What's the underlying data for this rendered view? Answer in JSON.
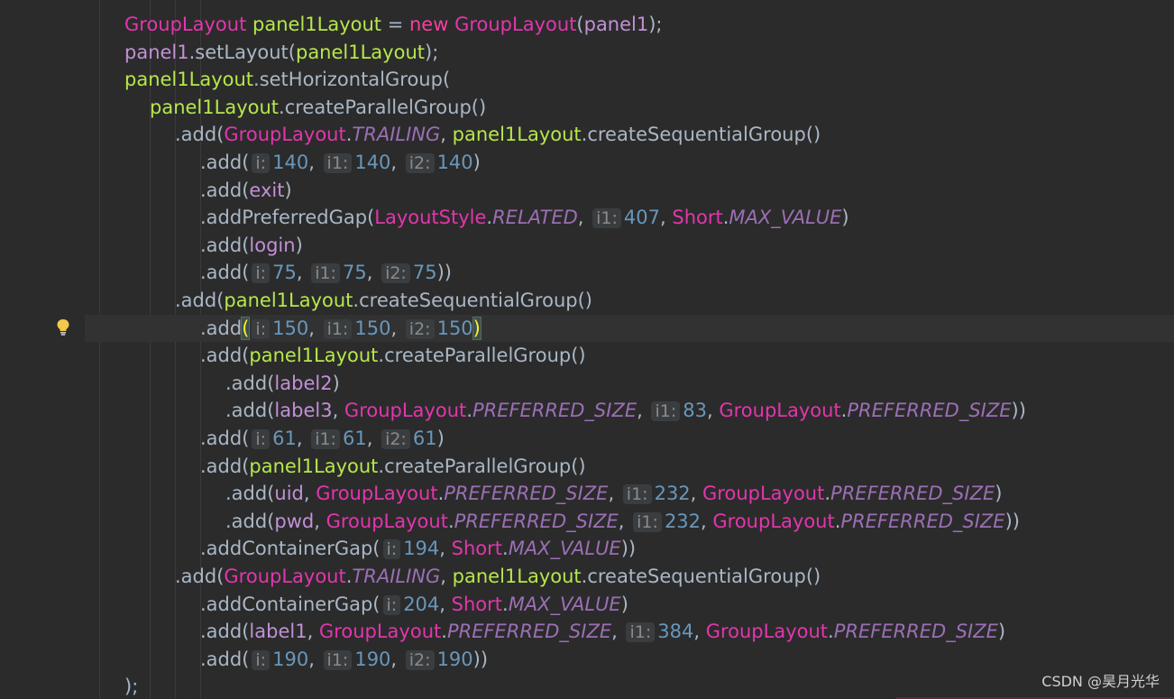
{
  "editor": {
    "watermark": "CSDN @昊月光华",
    "lines": [
      [
        {
          "t": "type",
          "v": "GroupLayout"
        },
        {
          "t": "plain",
          "v": " "
        },
        {
          "t": "var",
          "v": "panel1Layout"
        },
        {
          "t": "plain",
          "v": " = "
        },
        {
          "t": "kw",
          "v": "new"
        },
        {
          "t": "plain",
          "v": " "
        },
        {
          "t": "type",
          "v": "GroupLayout"
        },
        {
          "t": "plain",
          "v": "("
        },
        {
          "t": "ident",
          "v": "panel1"
        },
        {
          "t": "plain",
          "v": ");"
        }
      ],
      [
        {
          "t": "ident",
          "v": "panel1"
        },
        {
          "t": "plain",
          "v": ".setLayout("
        },
        {
          "t": "var",
          "v": "panel1Layout"
        },
        {
          "t": "plain",
          "v": ");"
        }
      ],
      [
        {
          "t": "var",
          "v": "panel1Layout"
        },
        {
          "t": "plain",
          "v": ".setHorizontalGroup("
        }
      ],
      [
        {
          "t": "var",
          "v": "panel1Layout"
        },
        {
          "t": "plain",
          "v": ".createParallelGroup()"
        }
      ],
      [
        {
          "t": "plain",
          "v": ".add("
        },
        {
          "t": "type",
          "v": "GroupLayout"
        },
        {
          "t": "plain",
          "v": "."
        },
        {
          "t": "field",
          "v": "TRAILING"
        },
        {
          "t": "plain",
          "v": ", "
        },
        {
          "t": "var",
          "v": "panel1Layout"
        },
        {
          "t": "plain",
          "v": ".createSequentialGroup()"
        }
      ],
      [
        {
          "t": "plain",
          "v": ".add("
        },
        {
          "t": "hint",
          "v": "i:"
        },
        {
          "t": "num",
          "v": "140"
        },
        {
          "t": "plain",
          "v": ", "
        },
        {
          "t": "hint",
          "v": "i1:"
        },
        {
          "t": "num",
          "v": "140"
        },
        {
          "t": "plain",
          "v": ", "
        },
        {
          "t": "hint",
          "v": "i2:"
        },
        {
          "t": "num",
          "v": "140"
        },
        {
          "t": "plain",
          "v": ")"
        }
      ],
      [
        {
          "t": "plain",
          "v": ".add("
        },
        {
          "t": "ident",
          "v": "exit"
        },
        {
          "t": "plain",
          "v": ")"
        }
      ],
      [
        {
          "t": "plain",
          "v": ".addPreferredGap("
        },
        {
          "t": "type",
          "v": "LayoutStyle"
        },
        {
          "t": "plain",
          "v": "."
        },
        {
          "t": "field",
          "v": "RELATED"
        },
        {
          "t": "plain",
          "v": ", "
        },
        {
          "t": "hint",
          "v": "i1:"
        },
        {
          "t": "num",
          "v": "407"
        },
        {
          "t": "plain",
          "v": ", "
        },
        {
          "t": "type",
          "v": "Short"
        },
        {
          "t": "plain",
          "v": "."
        },
        {
          "t": "field",
          "v": "MAX_VALUE"
        },
        {
          "t": "plain",
          "v": ")"
        }
      ],
      [
        {
          "t": "plain",
          "v": ".add("
        },
        {
          "t": "ident",
          "v": "login"
        },
        {
          "t": "plain",
          "v": ")"
        }
      ],
      [
        {
          "t": "plain",
          "v": ".add("
        },
        {
          "t": "hint",
          "v": "i:"
        },
        {
          "t": "num",
          "v": "75"
        },
        {
          "t": "plain",
          "v": ", "
        },
        {
          "t": "hint",
          "v": "i1:"
        },
        {
          "t": "num",
          "v": "75"
        },
        {
          "t": "plain",
          "v": ", "
        },
        {
          "t": "hint",
          "v": "i2:"
        },
        {
          "t": "num",
          "v": "75"
        },
        {
          "t": "plain",
          "v": "))"
        }
      ],
      [
        {
          "t": "plain",
          "v": ".add("
        },
        {
          "t": "var",
          "v": "panel1Layout"
        },
        {
          "t": "plain",
          "v": ".createSequentialGroup()"
        }
      ],
      [
        {
          "t": "plain",
          "v": ".add"
        },
        {
          "t": "bracket",
          "v": "("
        },
        {
          "t": "hint",
          "v": "i:"
        },
        {
          "t": "num",
          "v": "150"
        },
        {
          "t": "plain",
          "v": ", "
        },
        {
          "t": "hint",
          "v": "i1:"
        },
        {
          "t": "num",
          "v": "150"
        },
        {
          "t": "plain",
          "v": ", "
        },
        {
          "t": "hint",
          "v": "i2:"
        },
        {
          "t": "num",
          "v": "150"
        },
        {
          "t": "bracket",
          "v": ")"
        }
      ],
      [
        {
          "t": "plain",
          "v": ".add("
        },
        {
          "t": "var",
          "v": "panel1Layout"
        },
        {
          "t": "plain",
          "v": ".createParallelGroup()"
        }
      ],
      [
        {
          "t": "plain",
          "v": ".add("
        },
        {
          "t": "ident",
          "v": "label2"
        },
        {
          "t": "plain",
          "v": ")"
        }
      ],
      [
        {
          "t": "plain",
          "v": ".add("
        },
        {
          "t": "ident",
          "v": "label3"
        },
        {
          "t": "plain",
          "v": ", "
        },
        {
          "t": "type",
          "v": "GroupLayout"
        },
        {
          "t": "plain",
          "v": "."
        },
        {
          "t": "field",
          "v": "PREFERRED_SIZE"
        },
        {
          "t": "plain",
          "v": ", "
        },
        {
          "t": "hint",
          "v": "i1:"
        },
        {
          "t": "num",
          "v": "83"
        },
        {
          "t": "plain",
          "v": ", "
        },
        {
          "t": "type",
          "v": "GroupLayout"
        },
        {
          "t": "plain",
          "v": "."
        },
        {
          "t": "field",
          "v": "PREFERRED_SIZE"
        },
        {
          "t": "plain",
          "v": "))"
        }
      ],
      [
        {
          "t": "plain",
          "v": ".add("
        },
        {
          "t": "hint",
          "v": "i:"
        },
        {
          "t": "num",
          "v": "61"
        },
        {
          "t": "plain",
          "v": ", "
        },
        {
          "t": "hint",
          "v": "i1:"
        },
        {
          "t": "num",
          "v": "61"
        },
        {
          "t": "plain",
          "v": ", "
        },
        {
          "t": "hint",
          "v": "i2:"
        },
        {
          "t": "num",
          "v": "61"
        },
        {
          "t": "plain",
          "v": ")"
        }
      ],
      [
        {
          "t": "plain",
          "v": ".add("
        },
        {
          "t": "var",
          "v": "panel1Layout"
        },
        {
          "t": "plain",
          "v": ".createParallelGroup()"
        }
      ],
      [
        {
          "t": "plain",
          "v": ".add("
        },
        {
          "t": "ident",
          "v": "uid"
        },
        {
          "t": "plain",
          "v": ", "
        },
        {
          "t": "type",
          "v": "GroupLayout"
        },
        {
          "t": "plain",
          "v": "."
        },
        {
          "t": "field",
          "v": "PREFERRED_SIZE"
        },
        {
          "t": "plain",
          "v": ", "
        },
        {
          "t": "hint",
          "v": "i1:"
        },
        {
          "t": "num",
          "v": "232"
        },
        {
          "t": "plain",
          "v": ", "
        },
        {
          "t": "type",
          "v": "GroupLayout"
        },
        {
          "t": "plain",
          "v": "."
        },
        {
          "t": "field",
          "v": "PREFERRED_SIZE"
        },
        {
          "t": "plain",
          "v": ")"
        }
      ],
      [
        {
          "t": "plain",
          "v": ".add("
        },
        {
          "t": "ident",
          "v": "pwd"
        },
        {
          "t": "plain",
          "v": ", "
        },
        {
          "t": "type",
          "v": "GroupLayout"
        },
        {
          "t": "plain",
          "v": "."
        },
        {
          "t": "field",
          "v": "PREFERRED_SIZE"
        },
        {
          "t": "plain",
          "v": ", "
        },
        {
          "t": "hint",
          "v": "i1:"
        },
        {
          "t": "num",
          "v": "232"
        },
        {
          "t": "plain",
          "v": ", "
        },
        {
          "t": "type",
          "v": "GroupLayout"
        },
        {
          "t": "plain",
          "v": "."
        },
        {
          "t": "field",
          "v": "PREFERRED_SIZE"
        },
        {
          "t": "plain",
          "v": "))"
        }
      ],
      [
        {
          "t": "plain",
          "v": ".addContainerGap("
        },
        {
          "t": "hint",
          "v": "i:"
        },
        {
          "t": "num",
          "v": "194"
        },
        {
          "t": "plain",
          "v": ", "
        },
        {
          "t": "type",
          "v": "Short"
        },
        {
          "t": "plain",
          "v": "."
        },
        {
          "t": "field",
          "v": "MAX_VALUE"
        },
        {
          "t": "plain",
          "v": "))"
        }
      ],
      [
        {
          "t": "plain",
          "v": ".add("
        },
        {
          "t": "type",
          "v": "GroupLayout"
        },
        {
          "t": "plain",
          "v": "."
        },
        {
          "t": "field",
          "v": "TRAILING"
        },
        {
          "t": "plain",
          "v": ", "
        },
        {
          "t": "var",
          "v": "panel1Layout"
        },
        {
          "t": "plain",
          "v": ".createSequentialGroup()"
        }
      ],
      [
        {
          "t": "plain",
          "v": ".addContainerGap("
        },
        {
          "t": "hint",
          "v": "i:"
        },
        {
          "t": "num",
          "v": "204"
        },
        {
          "t": "plain",
          "v": ", "
        },
        {
          "t": "type",
          "v": "Short"
        },
        {
          "t": "plain",
          "v": "."
        },
        {
          "t": "field",
          "v": "MAX_VALUE"
        },
        {
          "t": "plain",
          "v": ")"
        }
      ],
      [
        {
          "t": "plain",
          "v": ".add("
        },
        {
          "t": "ident",
          "v": "label1"
        },
        {
          "t": "plain",
          "v": ", "
        },
        {
          "t": "type",
          "v": "GroupLayout"
        },
        {
          "t": "plain",
          "v": "."
        },
        {
          "t": "field",
          "v": "PREFERRED_SIZE"
        },
        {
          "t": "plain",
          "v": ", "
        },
        {
          "t": "hint",
          "v": "i1:"
        },
        {
          "t": "num",
          "v": "384"
        },
        {
          "t": "plain",
          "v": ", "
        },
        {
          "t": "type",
          "v": "GroupLayout"
        },
        {
          "t": "plain",
          "v": "."
        },
        {
          "t": "field",
          "v": "PREFERRED_SIZE"
        },
        {
          "t": "plain",
          "v": ")"
        }
      ],
      [
        {
          "t": "plain",
          "v": ".add("
        },
        {
          "t": "hint",
          "v": "i:"
        },
        {
          "t": "num",
          "v": "190"
        },
        {
          "t": "plain",
          "v": ", "
        },
        {
          "t": "hint",
          "v": "i1:"
        },
        {
          "t": "num",
          "v": "190"
        },
        {
          "t": "plain",
          "v": ", "
        },
        {
          "t": "hint",
          "v": "i2:"
        },
        {
          "t": "num",
          "v": "190"
        },
        {
          "t": "plain",
          "v": "))"
        }
      ],
      [
        {
          "t": "plain",
          "v": ");"
        }
      ]
    ]
  }
}
